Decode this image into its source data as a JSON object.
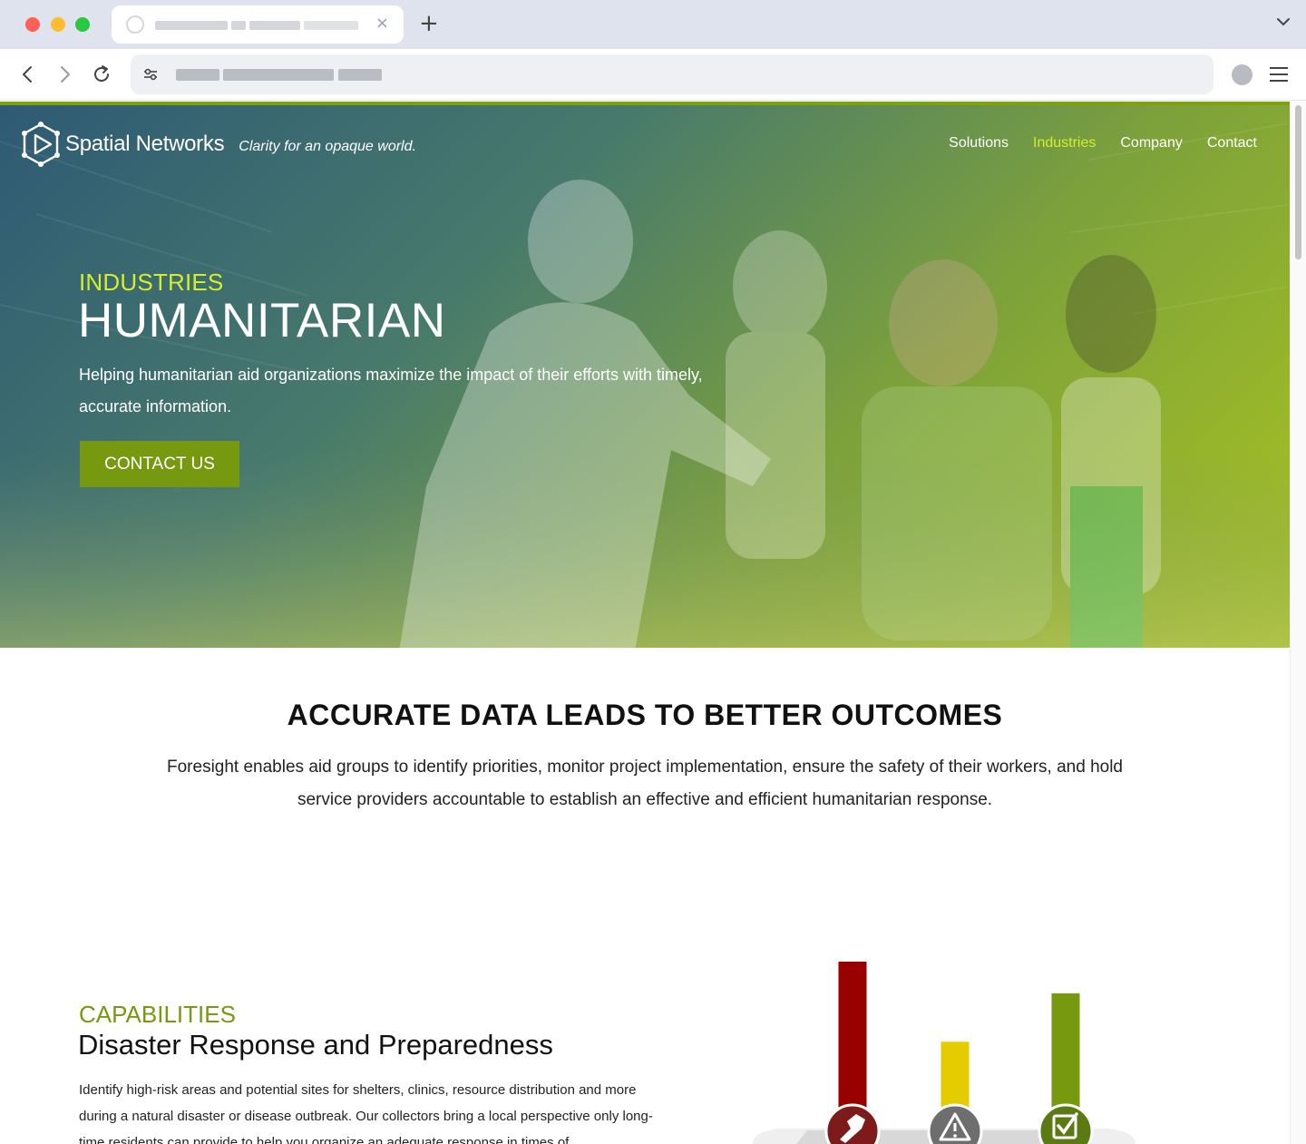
{
  "browser": {
    "tab_close_glyph": "×",
    "new_tab_glyph": "+",
    "icons": [
      "back-icon",
      "forward-icon",
      "reload-icon",
      "site-settings-icon",
      "profile-icon",
      "menu-icon",
      "tab-list-chevron-icon"
    ]
  },
  "header": {
    "brand_name": "Spatial Networks",
    "tagline": "Clarity for an opaque world.",
    "nav": [
      {
        "label": "Solutions"
      },
      {
        "label": "Industries",
        "active": true
      },
      {
        "label": "Company"
      },
      {
        "label": "Contact"
      }
    ]
  },
  "hero": {
    "eyebrow": "INDUSTRIES",
    "title": "HUMANITARIAN",
    "subtitle": "Helping humanitarian aid organizations maximize the impact of their efforts with timely, accurate information.",
    "cta_label": "CONTACT US"
  },
  "outcomes": {
    "title": "ACCURATE DATA LEADS TO BETTER OUTCOMES",
    "body": "Foresight enables aid groups to identify priorities, monitor project implementation, ensure the safety of their workers, and hold service providers accountable to establish an effective and efficient humanitarian response."
  },
  "capabilities": {
    "eyebrow": "CAPABILITIES",
    "title": "Disaster Response and Preparedness",
    "body": "Identify high-risk areas and potential sites for shelters, clinics, resource distribution and more during a natural disaster or disease outbreak. Our collectors bring a local perspective only long-time residents can provide to help you organize an adequate response in times of",
    "illustration": {
      "bars": [
        {
          "level": 1.0,
          "color": "#990000",
          "icon": "raised-fist-icon"
        },
        {
          "level": 0.52,
          "color": "#e5cc00",
          "icon": "warning-icon"
        },
        {
          "level": 0.81,
          "color": "#76990f",
          "icon": "checkbox-icon"
        }
      ]
    }
  },
  "colors": {
    "accent_green": "#76990f",
    "accent_lime": "#d4ed2e",
    "red": "#990000",
    "yellow": "#e5cc00"
  }
}
